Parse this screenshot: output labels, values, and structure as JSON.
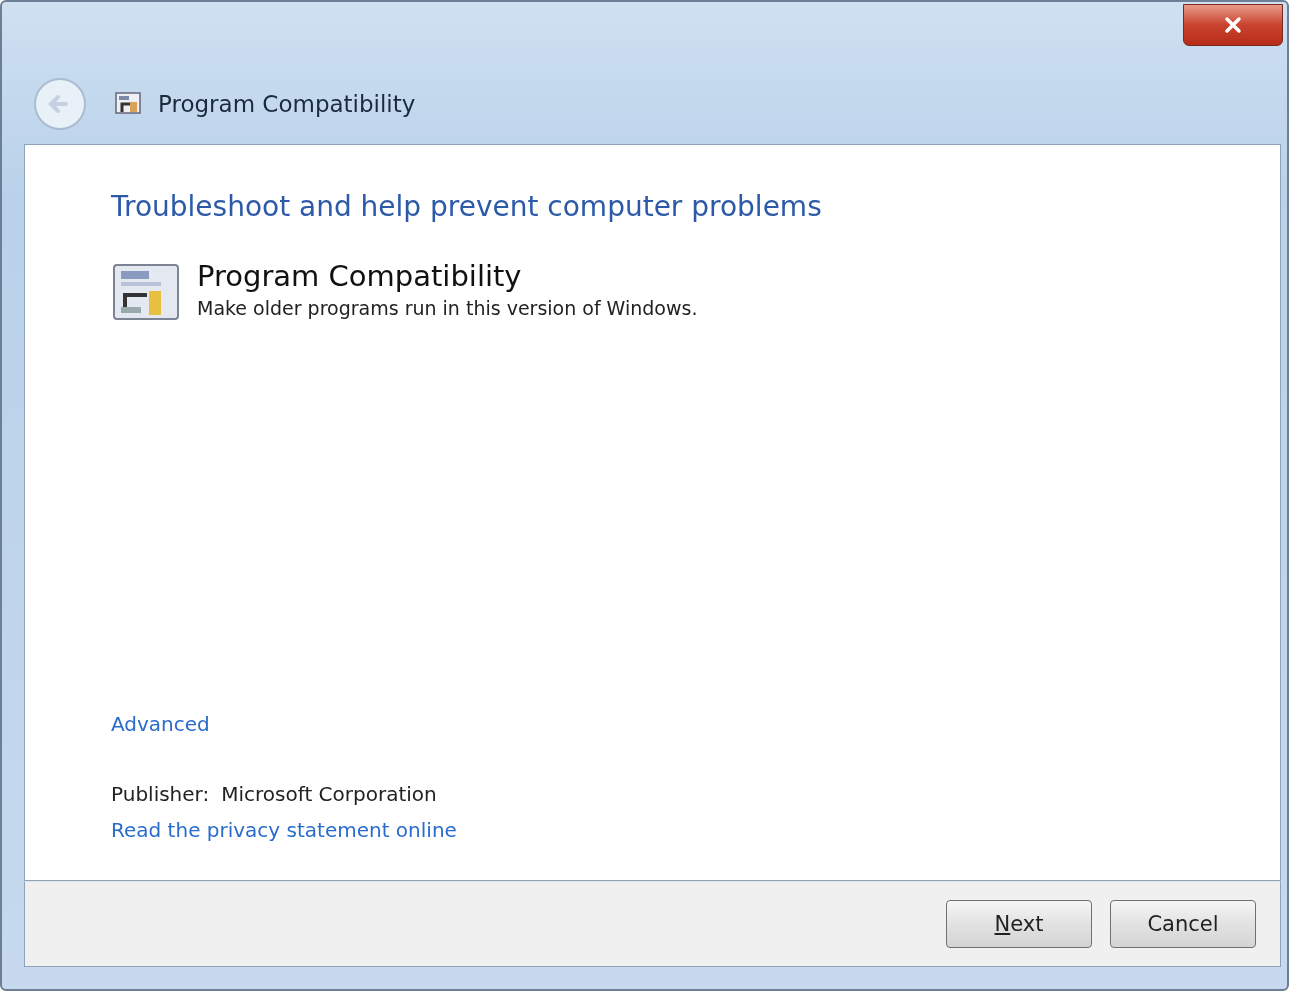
{
  "window": {
    "title": "Program Compatibility"
  },
  "heading": "Troubleshoot and help prevent computer problems",
  "troubleshooter": {
    "title": "Program Compatibility",
    "description": "Make older programs run in this version of Windows."
  },
  "advanced_link": "Advanced",
  "publisher": {
    "label": "Publisher:",
    "value": "Microsoft Corporation"
  },
  "privacy_link": "Read the privacy statement online",
  "buttons": [
    {
      "label": "Next",
      "access_key": true
    },
    {
      "label": "Cancel",
      "access_key": false
    }
  ]
}
